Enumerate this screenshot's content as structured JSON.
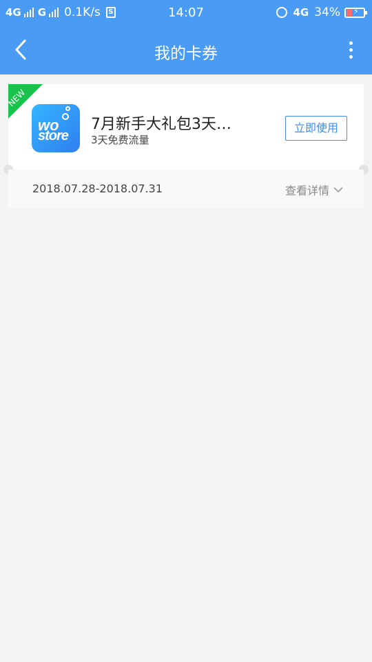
{
  "status_bar": {
    "net1": "4G",
    "net2": "G",
    "speed": "0.1K/s",
    "s_icon": "S",
    "time": "14:07",
    "net3": "4G",
    "battery_pct": "34%",
    "battery_level": 0.34
  },
  "nav": {
    "title": "我的卡券",
    "back_icon": "chevron-left-icon",
    "more_icon": "more-vertical-icon"
  },
  "coupon": {
    "badge": "NEW",
    "logo_line1": "wo",
    "logo_line2": "store",
    "title": "7月新手大礼包3天…",
    "description": "3天免费流量",
    "use_button": "立即使用",
    "date_range": "2018.07.28-2018.07.31",
    "details_link": "查看详情"
  },
  "colors": {
    "primary": "#4a9bf3",
    "badge_green": "#19c24a",
    "button_border": "#3e8ef0",
    "background": "#f3f3f3"
  }
}
